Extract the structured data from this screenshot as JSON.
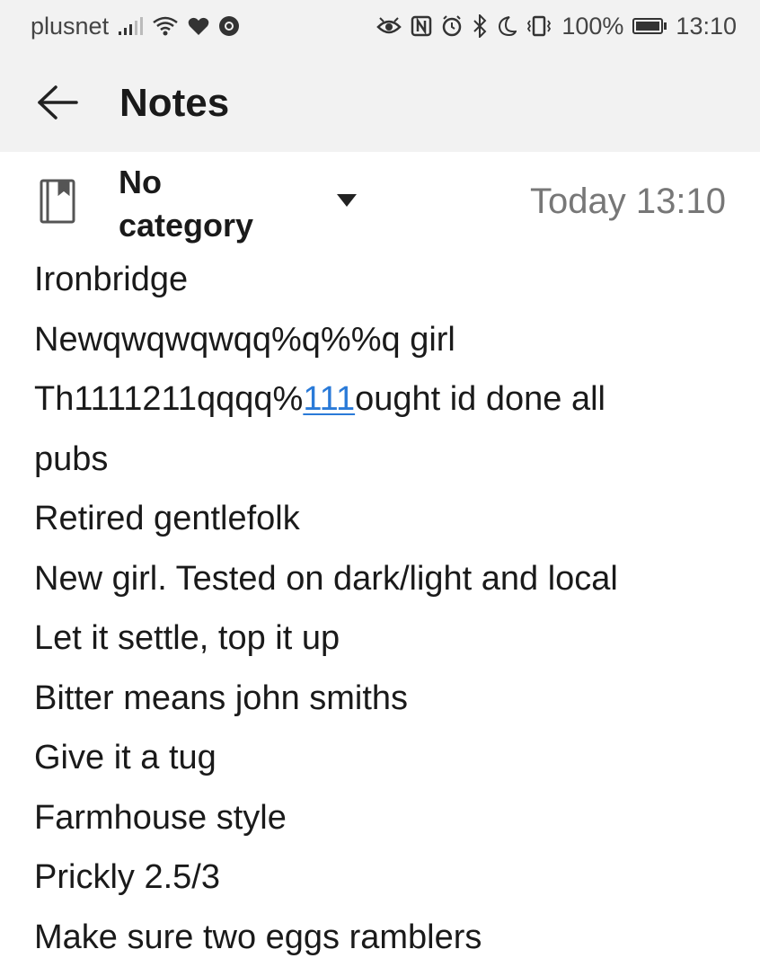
{
  "status_bar": {
    "carrier": "plusnet",
    "battery_percent": "100%",
    "time": "13:10",
    "left_icons": [
      "signal-icon",
      "wifi-icon",
      "heart-icon",
      "chrome-icon"
    ],
    "right_icons": [
      "eye-icon",
      "nfc-icon",
      "alarm-icon",
      "bluetooth-icon",
      "moon-icon",
      "vibrate-icon",
      "battery-icon"
    ],
    "battery_level": 1.0
  },
  "app_bar": {
    "title": "Notes",
    "back_icon": "arrow-left-icon"
  },
  "note_meta": {
    "category": "No category",
    "category_icon": "notebook-icon",
    "dropdown_icon": "triangle-down-icon",
    "date": "Today 13:10"
  },
  "note": {
    "line1": "Ironbridge",
    "line2": "Newqwqwqwqq%q%%q girl",
    "line3_prefix": "Th1111211qqqq%",
    "line3_link": "111",
    "line3_suffix": "ought id done all",
    "line4": "pubs",
    "line5": "Retired gentlefolk",
    "line6": "New girl. Tested on dark/light and local",
    "line7": "Let it settle, top it up",
    "line8": "Bitter means john smiths",
    "line9": "Give it a tug",
    "line10": "Farmhouse style",
    "line11": "Prickly 2.5/3",
    "line12": "Make sure two eggs ramblers"
  },
  "colors": {
    "bar_background": "#f2f2f2",
    "link": "#2a7ad8",
    "date_text": "#777777"
  }
}
